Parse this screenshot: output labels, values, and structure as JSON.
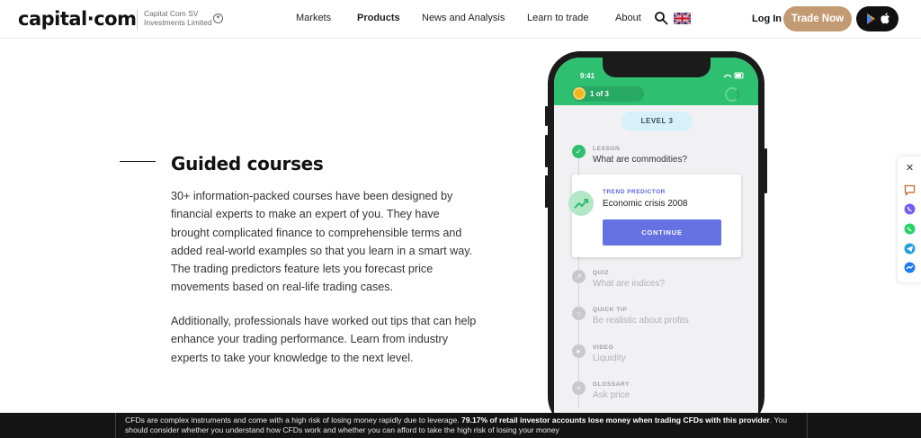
{
  "header": {
    "logo": "capital·com",
    "entity": "Capital Com SV Investments Limited",
    "nav": [
      "Markets",
      "Products",
      "News and Analysis",
      "Learn to trade",
      "About"
    ],
    "active_nav": "Products",
    "login": "Log In",
    "trade_now": "Trade Now"
  },
  "main": {
    "title": "Guided courses",
    "paragraph1": "30+ information-packed courses have been designed by financial experts to make an expert of you. They have brought complicated finance to comprehensible terms and added real-world examples so that you learn in a smart way. The trading predictors feature lets you forecast price movements based on real-life trading cases.",
    "paragraph2": "Additionally, professionals have worked out tips that can help enhance your trading performance. Learn from industry experts to take your knowledge to the next level."
  },
  "phone": {
    "time": "9:41",
    "progress": "1 of 3",
    "level": "LEVEL 3",
    "card": {
      "kind": "TREND PREDICTOR",
      "title": "Economic crisis 2008",
      "button": "CONTINUE"
    },
    "items": [
      {
        "kind": "LESSON",
        "title": "What are commodities?"
      },
      {
        "kind": "QUIZ",
        "title": "What are indices?"
      },
      {
        "kind": "QUICK TIP",
        "title": "Be realistic about profits"
      },
      {
        "kind": "VIDEO",
        "title": "Liquidity"
      },
      {
        "kind": "GLOSSARY",
        "title": "Ask price"
      }
    ]
  },
  "risk": {
    "part1": "CFDs are complex instruments and come with a high risk of losing money rapidly due to leverage.",
    "bold": "79.17% of retail investor accounts lose money when trading CFDs with this provider",
    "part2": ". You should consider whether you understand how CFDs work and whether you can afford to take the high risk of losing your money"
  },
  "colors": {
    "accent": "#c39b73",
    "green": "#2fbf71",
    "indigo": "#6672e2"
  }
}
